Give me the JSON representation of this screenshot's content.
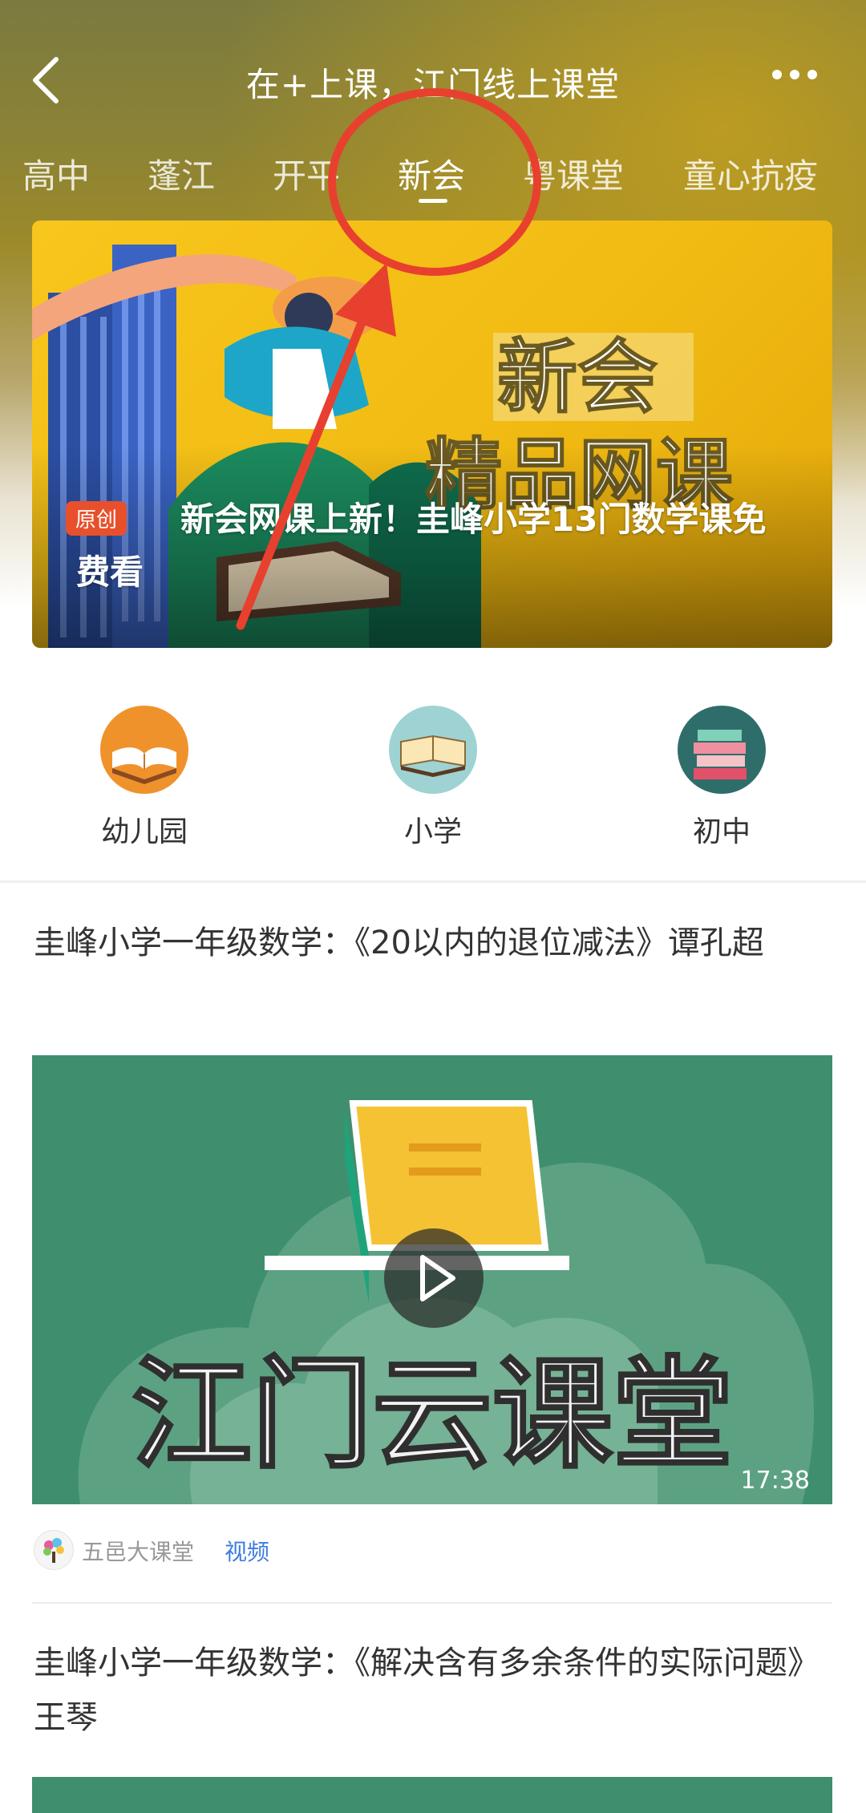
{
  "header": {
    "title": "在+上课，江门线上课堂",
    "back_icon": "chevron-left-icon",
    "more_icon": "more-dots-icon"
  },
  "tabs": [
    {
      "label": "高中",
      "active": false
    },
    {
      "label": "蓬江",
      "active": false
    },
    {
      "label": "开平",
      "active": false
    },
    {
      "label": "新会",
      "active": true
    },
    {
      "label": "粤课堂",
      "active": false
    },
    {
      "label": "童心抗疫",
      "active": false
    }
  ],
  "banner": {
    "badge": "原创",
    "caption": "新会网课上新！圭峰小学13门数学课免费看",
    "art_text_1": "新会",
    "art_text_2": "精品网课"
  },
  "categories": [
    {
      "label": "幼儿园",
      "icon": "open-book-icon",
      "color": "#f0922b"
    },
    {
      "label": "小学",
      "icon": "book-icon",
      "color": "#9fd3d3"
    },
    {
      "label": "初中",
      "icon": "stacked-books-icon",
      "color": "#2f6d6a"
    }
  ],
  "articles": [
    {
      "title": "圭峰小学一年级数学：《20以内的退位减法》谭孔超",
      "thumb_text": "江门云课堂",
      "duration": "17:38",
      "source": "五邑大课堂",
      "type": "视频"
    },
    {
      "title": "圭峰小学一年级数学：《解决含有多余条件的实际问题》王琴"
    }
  ],
  "colors": {
    "accent_red": "#e8402f",
    "banner_yellow": "#f8c61c",
    "video_green": "#3f8f6e",
    "link_blue": "#3b7de0"
  }
}
